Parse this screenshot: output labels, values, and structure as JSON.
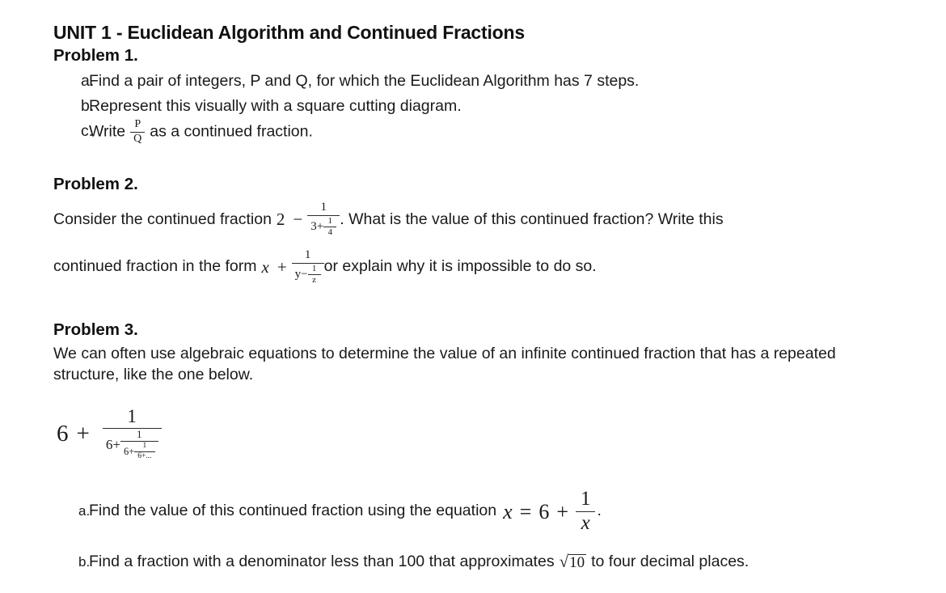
{
  "document": {
    "unit_title": "UNIT 1 - Euclidean Algorithm and Continued Fractions",
    "background_color": "#ffffff",
    "text_color": "#1a1a1a"
  },
  "problem1": {
    "heading": "Problem 1.",
    "items": [
      {
        "marker": "a.",
        "text": "Find a pair of integers, P and Q, for which the Euclidean Algorithm has 7 steps."
      },
      {
        "marker": "b.",
        "text": "Represent this visually with a square cutting diagram."
      },
      {
        "marker": "c.",
        "text_before": "Write",
        "text_after": "as a continued fraction.",
        "fraction": {
          "numerator": "P",
          "denominator": "Q"
        }
      }
    ]
  },
  "problem2": {
    "heading": "Problem 2.",
    "line1": {
      "text_before": "Consider the continued fraction",
      "integer": "2",
      "operator": "−",
      "fraction": {
        "numerator": "1",
        "denominator_lead": "3+",
        "denominator_fraction": {
          "numerator": "1",
          "denominator": "4"
        }
      },
      "text_after": ". What is the value of this continued fraction? Write this"
    },
    "line2": {
      "text_before": "continued fraction in the form",
      "variable": "x",
      "operator": "+",
      "fraction": {
        "numerator": "1",
        "denominator_lead": "y−",
        "denominator_fraction": {
          "numerator": "1",
          "denominator": "z"
        }
      },
      "text_after": "or explain why it is impossible to do so."
    }
  },
  "problem3": {
    "heading": "Problem 3.",
    "paragraph": "We can often use algebraic equations to determine the value of an infinite continued fraction that has a repeated structure, like the one below.",
    "continued_fraction": {
      "lead_integer": "6",
      "lead_operator": "+",
      "level1": {
        "numerator": "1",
        "denominator_lead": "6+"
      },
      "level2": {
        "numerator": "1",
        "denominator_lead": "6+"
      },
      "level3": {
        "numerator": "1",
        "denominator_lead": "6+",
        "denominator_tail": "6+..."
      }
    },
    "items": [
      {
        "marker": "a.",
        "text_before": "Find the value of this continued fraction using the equation",
        "equation": {
          "lhs": "x",
          "equals": "=",
          "integer": "6",
          "operator": "+",
          "fraction": {
            "numerator": "1",
            "denominator": "x"
          }
        },
        "text_after": "."
      },
      {
        "marker": "b.",
        "text_before": "Find a fraction with a denominator less than 100 that approximates",
        "radical": {
          "symbol": "√",
          "radicand": "10"
        },
        "text_after": "to four decimal places."
      }
    ]
  }
}
